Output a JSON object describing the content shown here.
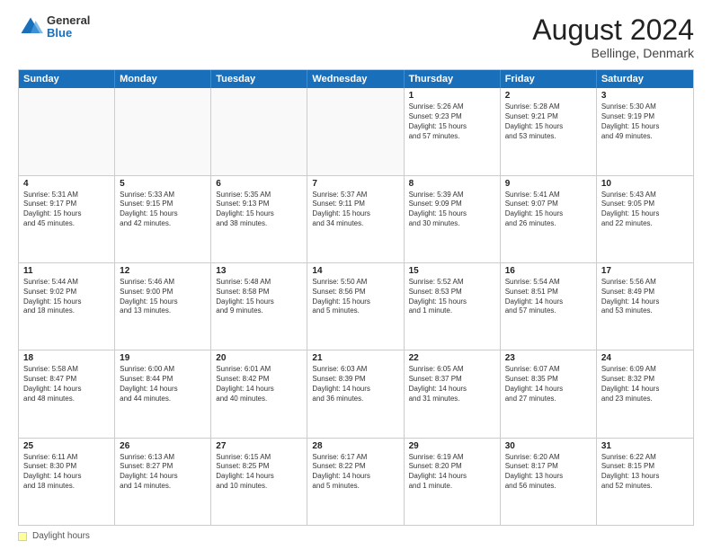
{
  "logo": {
    "general": "General",
    "blue": "Blue"
  },
  "header": {
    "month_year": "August 2024",
    "location": "Bellinge, Denmark"
  },
  "days_of_week": [
    "Sunday",
    "Monday",
    "Tuesday",
    "Wednesday",
    "Thursday",
    "Friday",
    "Saturday"
  ],
  "footer": {
    "label": "Daylight hours"
  },
  "weeks": [
    [
      {
        "day": "",
        "text": "",
        "empty": true
      },
      {
        "day": "",
        "text": "",
        "empty": true
      },
      {
        "day": "",
        "text": "",
        "empty": true
      },
      {
        "day": "",
        "text": "",
        "empty": true
      },
      {
        "day": "1",
        "text": "Sunrise: 5:26 AM\nSunset: 9:23 PM\nDaylight: 15 hours\nand 57 minutes.",
        "empty": false
      },
      {
        "day": "2",
        "text": "Sunrise: 5:28 AM\nSunset: 9:21 PM\nDaylight: 15 hours\nand 53 minutes.",
        "empty": false
      },
      {
        "day": "3",
        "text": "Sunrise: 5:30 AM\nSunset: 9:19 PM\nDaylight: 15 hours\nand 49 minutes.",
        "empty": false
      }
    ],
    [
      {
        "day": "4",
        "text": "Sunrise: 5:31 AM\nSunset: 9:17 PM\nDaylight: 15 hours\nand 45 minutes.",
        "empty": false
      },
      {
        "day": "5",
        "text": "Sunrise: 5:33 AM\nSunset: 9:15 PM\nDaylight: 15 hours\nand 42 minutes.",
        "empty": false
      },
      {
        "day": "6",
        "text": "Sunrise: 5:35 AM\nSunset: 9:13 PM\nDaylight: 15 hours\nand 38 minutes.",
        "empty": false
      },
      {
        "day": "7",
        "text": "Sunrise: 5:37 AM\nSunset: 9:11 PM\nDaylight: 15 hours\nand 34 minutes.",
        "empty": false
      },
      {
        "day": "8",
        "text": "Sunrise: 5:39 AM\nSunset: 9:09 PM\nDaylight: 15 hours\nand 30 minutes.",
        "empty": false
      },
      {
        "day": "9",
        "text": "Sunrise: 5:41 AM\nSunset: 9:07 PM\nDaylight: 15 hours\nand 26 minutes.",
        "empty": false
      },
      {
        "day": "10",
        "text": "Sunrise: 5:43 AM\nSunset: 9:05 PM\nDaylight: 15 hours\nand 22 minutes.",
        "empty": false
      }
    ],
    [
      {
        "day": "11",
        "text": "Sunrise: 5:44 AM\nSunset: 9:02 PM\nDaylight: 15 hours\nand 18 minutes.",
        "empty": false
      },
      {
        "day": "12",
        "text": "Sunrise: 5:46 AM\nSunset: 9:00 PM\nDaylight: 15 hours\nand 13 minutes.",
        "empty": false
      },
      {
        "day": "13",
        "text": "Sunrise: 5:48 AM\nSunset: 8:58 PM\nDaylight: 15 hours\nand 9 minutes.",
        "empty": false
      },
      {
        "day": "14",
        "text": "Sunrise: 5:50 AM\nSunset: 8:56 PM\nDaylight: 15 hours\nand 5 minutes.",
        "empty": false
      },
      {
        "day": "15",
        "text": "Sunrise: 5:52 AM\nSunset: 8:53 PM\nDaylight: 15 hours\nand 1 minute.",
        "empty": false
      },
      {
        "day": "16",
        "text": "Sunrise: 5:54 AM\nSunset: 8:51 PM\nDaylight: 14 hours\nand 57 minutes.",
        "empty": false
      },
      {
        "day": "17",
        "text": "Sunrise: 5:56 AM\nSunset: 8:49 PM\nDaylight: 14 hours\nand 53 minutes.",
        "empty": false
      }
    ],
    [
      {
        "day": "18",
        "text": "Sunrise: 5:58 AM\nSunset: 8:47 PM\nDaylight: 14 hours\nand 48 minutes.",
        "empty": false
      },
      {
        "day": "19",
        "text": "Sunrise: 6:00 AM\nSunset: 8:44 PM\nDaylight: 14 hours\nand 44 minutes.",
        "empty": false
      },
      {
        "day": "20",
        "text": "Sunrise: 6:01 AM\nSunset: 8:42 PM\nDaylight: 14 hours\nand 40 minutes.",
        "empty": false
      },
      {
        "day": "21",
        "text": "Sunrise: 6:03 AM\nSunset: 8:39 PM\nDaylight: 14 hours\nand 36 minutes.",
        "empty": false
      },
      {
        "day": "22",
        "text": "Sunrise: 6:05 AM\nSunset: 8:37 PM\nDaylight: 14 hours\nand 31 minutes.",
        "empty": false
      },
      {
        "day": "23",
        "text": "Sunrise: 6:07 AM\nSunset: 8:35 PM\nDaylight: 14 hours\nand 27 minutes.",
        "empty": false
      },
      {
        "day": "24",
        "text": "Sunrise: 6:09 AM\nSunset: 8:32 PM\nDaylight: 14 hours\nand 23 minutes.",
        "empty": false
      }
    ],
    [
      {
        "day": "25",
        "text": "Sunrise: 6:11 AM\nSunset: 8:30 PM\nDaylight: 14 hours\nand 18 minutes.",
        "empty": false
      },
      {
        "day": "26",
        "text": "Sunrise: 6:13 AM\nSunset: 8:27 PM\nDaylight: 14 hours\nand 14 minutes.",
        "empty": false
      },
      {
        "day": "27",
        "text": "Sunrise: 6:15 AM\nSunset: 8:25 PM\nDaylight: 14 hours\nand 10 minutes.",
        "empty": false
      },
      {
        "day": "28",
        "text": "Sunrise: 6:17 AM\nSunset: 8:22 PM\nDaylight: 14 hours\nand 5 minutes.",
        "empty": false
      },
      {
        "day": "29",
        "text": "Sunrise: 6:19 AM\nSunset: 8:20 PM\nDaylight: 14 hours\nand 1 minute.",
        "empty": false
      },
      {
        "day": "30",
        "text": "Sunrise: 6:20 AM\nSunset: 8:17 PM\nDaylight: 13 hours\nand 56 minutes.",
        "empty": false
      },
      {
        "day": "31",
        "text": "Sunrise: 6:22 AM\nSunset: 8:15 PM\nDaylight: 13 hours\nand 52 minutes.",
        "empty": false
      }
    ]
  ]
}
